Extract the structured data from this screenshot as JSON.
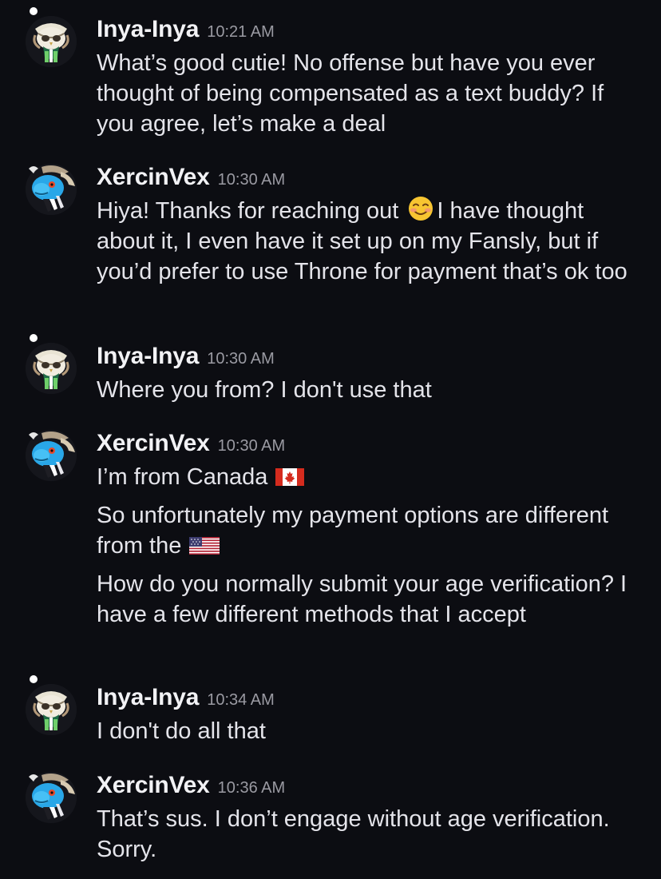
{
  "messages": [
    {
      "author": "Inya-Inya",
      "time": "10:21 AM",
      "avatar_icon": "owl-character-avatar",
      "lines": [
        "What’s good cutie! No offense but have you ever thought of being compensated as a text buddy? If you agree, let’s make a deal"
      ]
    },
    {
      "author": "XercinVex",
      "time": "10:30 AM",
      "avatar_icon": "blue-dragon-avatar",
      "lines": [
        {
          "before": "Hiya! Thanks for reaching out ",
          "emoji": "smiling-face-emoji",
          "after": "I have thought about it, I even have it set up on my Fansly, but if you’d prefer to use Throne for payment that’s ok too"
        }
      ]
    },
    {
      "author": "Inya-Inya",
      "time": "10:30 AM",
      "avatar_icon": "owl-character-avatar",
      "lines": [
        "Where you from? I don't use that"
      ]
    },
    {
      "author": "XercinVex",
      "time": "10:30 AM",
      "avatar_icon": "blue-dragon-avatar",
      "lines": [
        {
          "before": "I’m from Canada ",
          "emoji": "canada-flag-emoji",
          "after": ""
        },
        {
          "before": "So unfortunately my payment options are different from the ",
          "emoji": "us-flag-emoji",
          "after": ""
        },
        "How do you normally submit your age verification? I have a few different methods that I accept"
      ]
    },
    {
      "author": "Inya-Inya",
      "time": "10:34 AM",
      "avatar_icon": "owl-character-avatar",
      "lines": [
        "I don't do all that"
      ]
    },
    {
      "author": "XercinVex",
      "time": "10:36 AM",
      "avatar_icon": "blue-dragon-avatar",
      "lines": [
        "That’s sus. I don’t engage without age verification. Sorry."
      ]
    }
  ]
}
